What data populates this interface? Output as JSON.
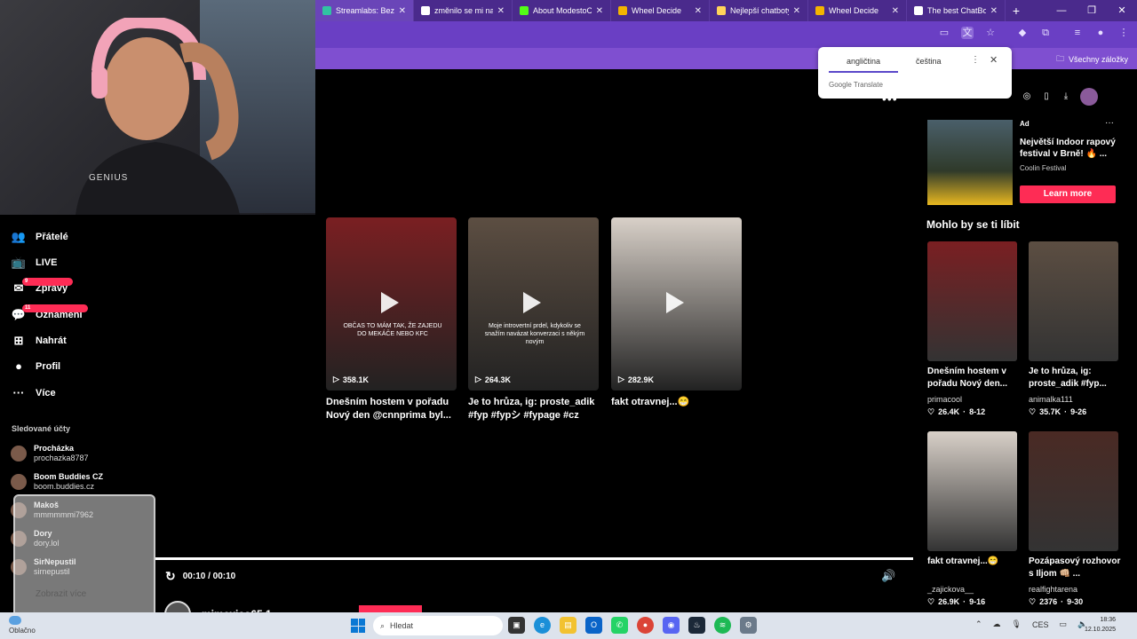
{
  "browser": {
    "tabs": [
      {
        "label": "Streamlabs: Bezpl",
        "color": "#31c3a2"
      },
      {
        "label": "změnilo se mi na",
        "color": "#ffffff"
      },
      {
        "label": "About ModestoC",
        "color": "#53fc18"
      },
      {
        "label": "Wheel Decide",
        "color": "#f4b400"
      },
      {
        "label": "Nejlepší chatboty",
        "color": "#ffd35a"
      },
      {
        "label": "Wheel Decide",
        "color": "#f4b400"
      },
      {
        "label": "The best ChatBot",
        "color": "#ffffff"
      }
    ],
    "active_tab": 0,
    "new_tab": "+",
    "bookmarks_all": "Všechny záložky"
  },
  "translate_popup": {
    "tab_from": "angličtina",
    "tab_to": "čeština",
    "more": "⋮",
    "close": "✕",
    "brand": "Google Translate"
  },
  "webcam": {
    "shirt_text": "GENIUS"
  },
  "nav": {
    "items": [
      {
        "label": "Přátelé",
        "icon": "friends-icon",
        "glyph": "👥",
        "badge": ""
      },
      {
        "label": "LIVE",
        "icon": "live-icon",
        "glyph": "📺",
        "badge": ""
      },
      {
        "label": "Zprávy",
        "icon": "messages-icon",
        "glyph": "✉",
        "badge": "9"
      },
      {
        "label": "Oznámení",
        "icon": "notifications-icon",
        "glyph": "💬",
        "badge": "11"
      },
      {
        "label": "Nahrát",
        "icon": "upload-icon",
        "glyph": "⊞",
        "badge": ""
      },
      {
        "label": "Profil",
        "icon": "profile-icon",
        "glyph": "●",
        "badge": ""
      },
      {
        "label": "Více",
        "icon": "more-icon",
        "glyph": "···",
        "badge": ""
      }
    ],
    "following_title": "Sledované účty",
    "following": [
      {
        "name": "Procházka",
        "user": "prochazka8787"
      },
      {
        "name": "Boom Buddies CZ",
        "user": "boom.buddies.cz"
      },
      {
        "name": "Makoš",
        "user": "mmmmmmi7962"
      },
      {
        "name": "Dory",
        "user": "dory.lol"
      },
      {
        "name": "SirNepustil",
        "user": "sirnepustil"
      }
    ],
    "show_more": "Zobrazit více"
  },
  "videos": [
    {
      "views": "358.1K",
      "caption": "Dnešním hostem v pořadu Nový den @cnnprima byl...",
      "overlay": "OBČAS TO MÁM TAK, ŽE ZAJEDU DO MEKÁČE NEBO KFC",
      "bg": "#7a1f22"
    },
    {
      "views": "264.3K",
      "caption": "Je to hrůza, ig: proste_adik #fyp #fypシ #fypage #cz",
      "overlay": "Moje introvertní prdel, kdykoliv se snažím navázat konverzaci s někým novým",
      "bg": "#5c4e42"
    },
    {
      "views": "282.9K",
      "caption": "fakt otravnej...😁",
      "overlay": "",
      "bg": "#d8d0c8"
    }
  ],
  "player": {
    "time": "00:10 / 00:10",
    "author": "mimexico65.1",
    "replay_icon": "↻",
    "volume_icon": "🔊"
  },
  "sidebar": {
    "ad": {
      "label": "Ad",
      "title": "Největší Indoor rapový festival v Brně! 🔥 ...",
      "brand": "Coolin Festival",
      "cta": "Learn more",
      "more": "···"
    },
    "rec_heading": "Mohlo by se ti líbit",
    "recommended": [
      {
        "title": "Dnešním hostem v pořadu Nový den...",
        "author": "primacool",
        "likes": "26.4K",
        "date": "8-12",
        "bg": "#7a1f22"
      },
      {
        "title": "Je to hrůza, ig: proste_adik #fyp...",
        "author": "animalka111",
        "likes": "35.7K",
        "date": "9-26",
        "bg": "#5c4e42"
      },
      {
        "title": "fakt otravnej...😁",
        "author": "_zajickova__",
        "likes": "26.9K",
        "date": "9-16",
        "bg": "#d8d0c8"
      },
      {
        "title": "Pozápasový rozhovor s Iljom 👊🏼 ...",
        "author": "realfightarena",
        "likes": "2376",
        "date": "9-30",
        "bg": "#4a2a24"
      }
    ]
  },
  "taskbar": {
    "weather": "Oblačno",
    "search_placeholder": "Hledat",
    "lang": "CES",
    "time": "18:36",
    "date": "12.10.2025"
  }
}
